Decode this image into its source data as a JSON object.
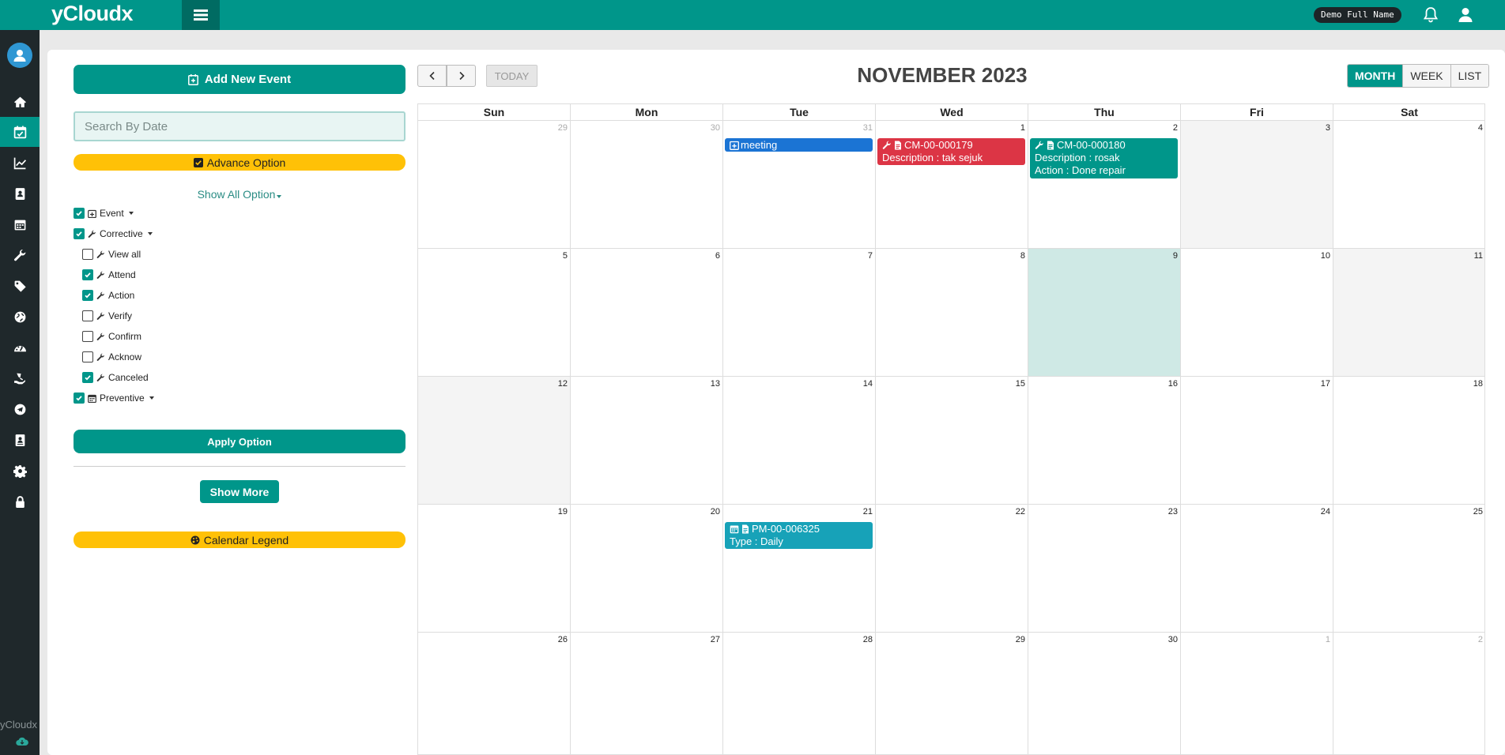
{
  "app": {
    "brand": "yCloudx",
    "user_name": "Demo Full Name"
  },
  "sidebar": {
    "brand": "yCloudx",
    "items": [
      {
        "name": "home-icon"
      },
      {
        "name": "calendar-check-icon"
      },
      {
        "name": "chart-line-icon"
      },
      {
        "name": "address-book-icon"
      },
      {
        "name": "calendar-icon"
      },
      {
        "name": "wrench-icon"
      },
      {
        "name": "tag-icon"
      },
      {
        "name": "globe-icon"
      },
      {
        "name": "dashboard-icon"
      },
      {
        "name": "hand-holding-icon"
      },
      {
        "name": "telegram-icon"
      },
      {
        "name": "contact-card-icon"
      },
      {
        "name": "gear-icon"
      },
      {
        "name": "lock-icon"
      }
    ]
  },
  "left_panel": {
    "add_event_label": "Add New Event",
    "search_placeholder": "Search By Date",
    "advance_label": "Advance Option",
    "show_all_label": "Show All Option",
    "options": {
      "event": {
        "label": "Event",
        "checked": true
      },
      "corrective": {
        "label": "Corrective",
        "checked": true
      },
      "view_all": {
        "label": "View all",
        "checked": false
      },
      "attend": {
        "label": "Attend",
        "checked": true
      },
      "action": {
        "label": "Action",
        "checked": true
      },
      "verify": {
        "label": "Verify",
        "checked": false
      },
      "confirm": {
        "label": "Confirm",
        "checked": false
      },
      "acknow": {
        "label": "Acknow",
        "checked": false
      },
      "canceled": {
        "label": "Canceled",
        "checked": true
      },
      "preventive": {
        "label": "Preventive",
        "checked": true
      }
    },
    "apply_label": "Apply Option",
    "show_more_label": "Show More",
    "legend_label": "Calendar Legend"
  },
  "calendar": {
    "title": "NOVEMBER 2023",
    "today_label": "TODAY",
    "views": {
      "month": "MONTH",
      "week": "WEEK",
      "list": "LIST"
    },
    "days_of_week": [
      "Sun",
      "Mon",
      "Tue",
      "Wed",
      "Thu",
      "Fri",
      "Sat"
    ],
    "weeks": [
      [
        "29",
        "30",
        "31",
        "1",
        "2",
        "3",
        "4"
      ],
      [
        "5",
        "6",
        "7",
        "8",
        "9",
        "10",
        "11"
      ],
      [
        "12",
        "13",
        "14",
        "15",
        "16",
        "17",
        "18"
      ],
      [
        "19",
        "20",
        "21",
        "22",
        "23",
        "24",
        "25"
      ],
      [
        "26",
        "27",
        "28",
        "29",
        "30",
        "1",
        "2"
      ]
    ],
    "events": [
      {
        "title": "meeting",
        "color": "#1b74d4"
      },
      {
        "title": "CM-00-000179",
        "line2": "Description : tak sejuk",
        "color": "#dc3545"
      },
      {
        "title": "CM-00-000180",
        "line2": "Description : rosak",
        "line3": "Action : Done repair",
        "color": "#00968a"
      },
      {
        "title": "PM-00-006325",
        "line2": "Type : Daily",
        "color": "#17a2b8"
      }
    ]
  },
  "colors": {
    "primary": "#00968a",
    "sidebar": "#1f282b",
    "warning": "#ffc107",
    "today": "#cfe9e5"
  }
}
